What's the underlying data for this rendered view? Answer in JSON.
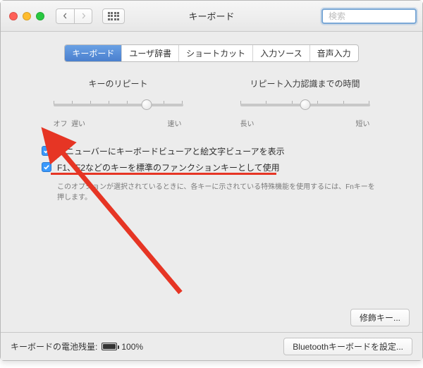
{
  "window": {
    "title": "キーボード"
  },
  "search": {
    "placeholder": "検索"
  },
  "tabs": [
    {
      "label": "キーボード",
      "active": true
    },
    {
      "label": "ユーザ辞書"
    },
    {
      "label": "ショートカット"
    },
    {
      "label": "入力ソース"
    },
    {
      "label": "音声入力"
    }
  ],
  "sliders": {
    "repeat": {
      "label": "キーのリピート",
      "left1": "オフ",
      "left2": "遅い",
      "right": "速い",
      "value_pct": 72
    },
    "delay": {
      "label": "リピート入力認識までの時間",
      "left": "長い",
      "right": "短い",
      "value_pct": 50
    }
  },
  "options": {
    "viewer": "メニューバーにキーボードビューアと絵文字ビューアを表示",
    "fnkeys": "F1、F2などのキーを標準のファンクションキーとして使用",
    "fn_note": "このオプションが選択されているときに、各キーに示されている特殊機能を使用するには、Fnキーを押します。"
  },
  "buttons": {
    "modifier": "修飾キー...",
    "bluetooth": "Bluetoothキーボードを設定..."
  },
  "footer": {
    "battery_label": "キーボードの電池残量:",
    "battery_pct": "100%"
  }
}
